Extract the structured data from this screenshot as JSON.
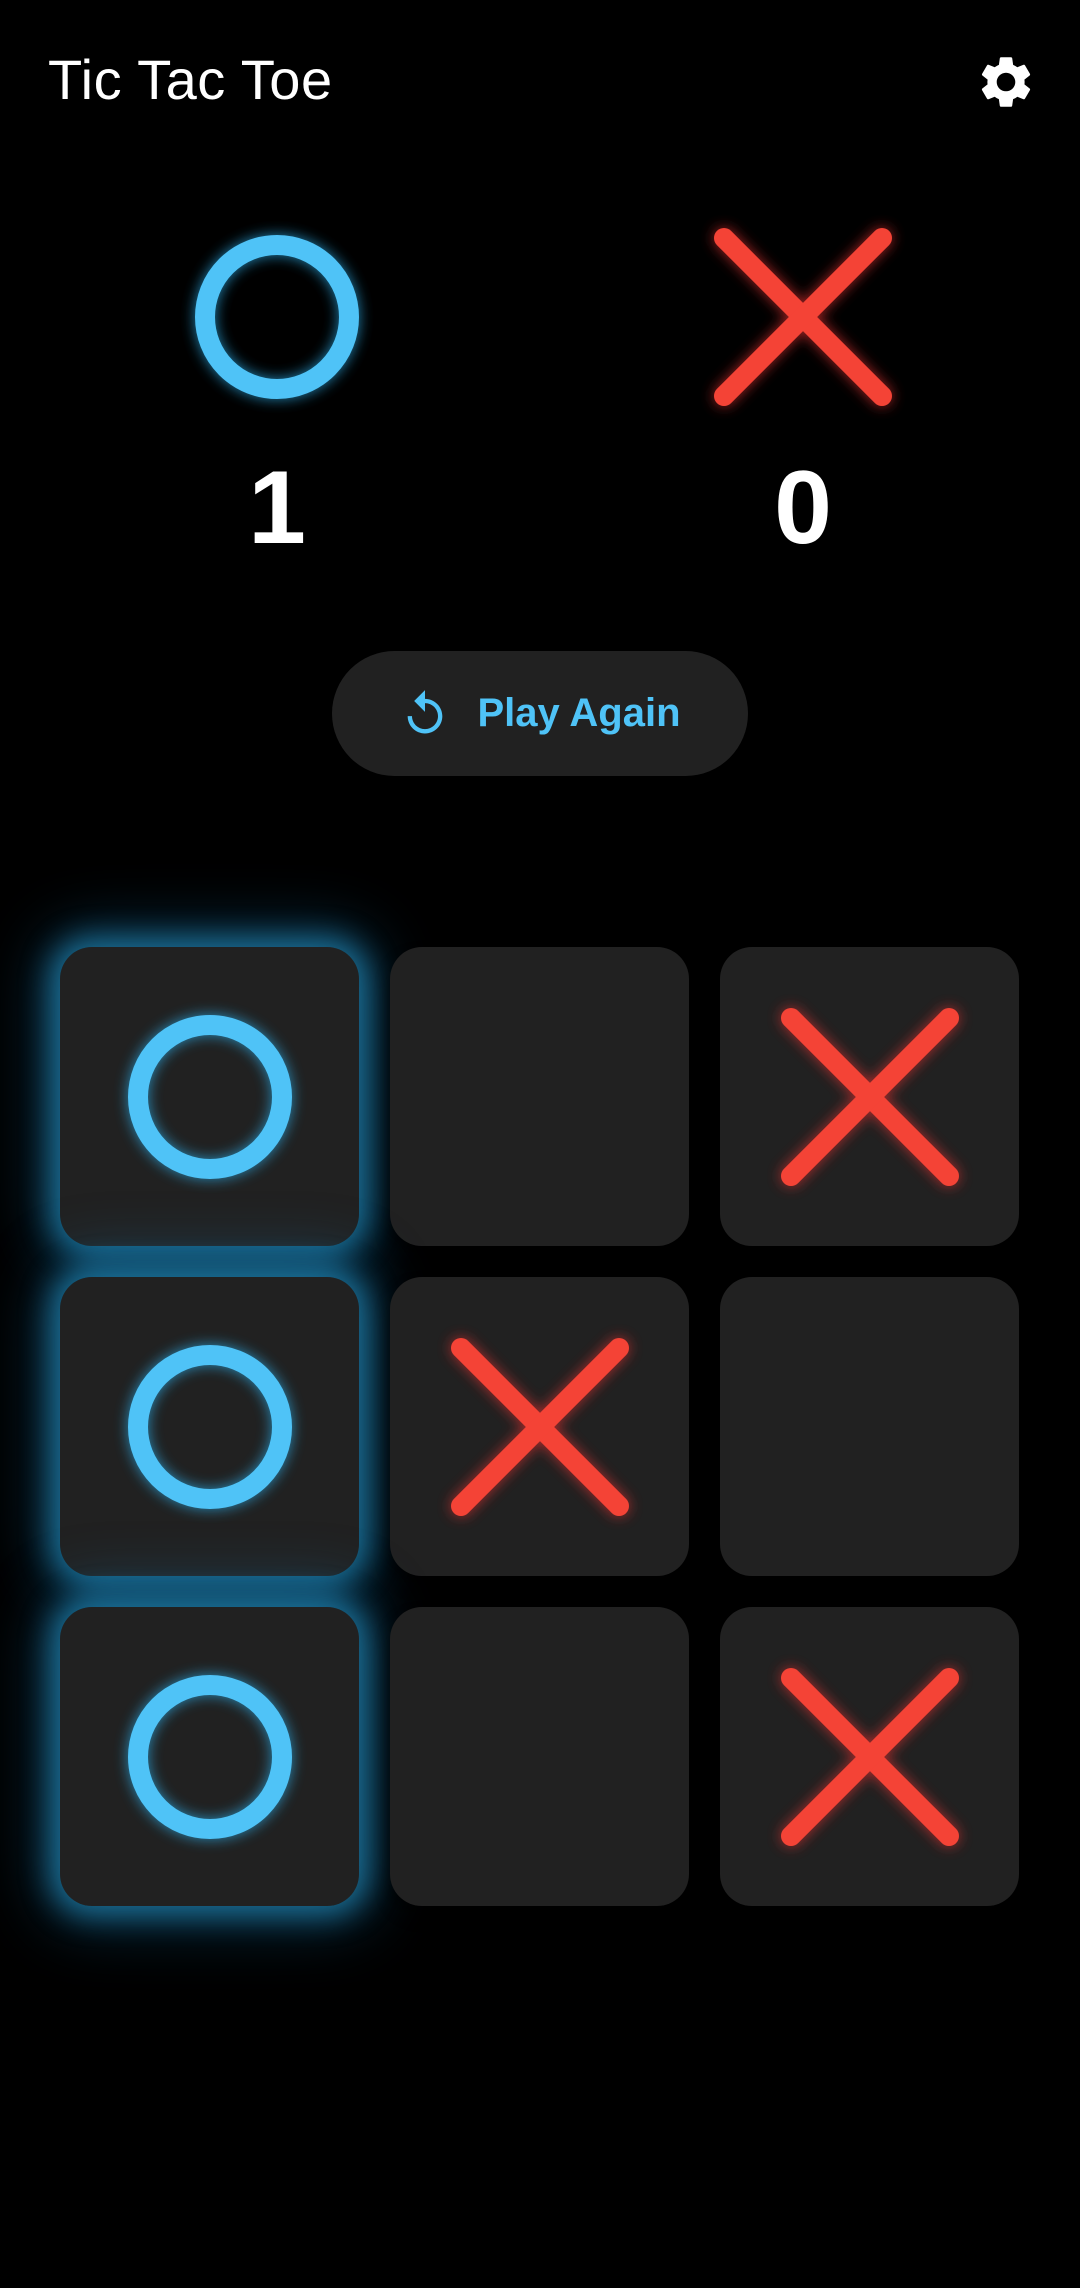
{
  "app": {
    "title": "Tic Tac Toe",
    "settings_icon": "gear-icon"
  },
  "scoreboard": {
    "o": {
      "symbol": "O",
      "score": "1",
      "color": "#4fc3f7"
    },
    "x": {
      "symbol": "X",
      "score": "0",
      "color": "#f44336"
    }
  },
  "actions": {
    "play_again_label": "Play Again",
    "play_again_icon": "replay-icon"
  },
  "board": {
    "cells": [
      "O",
      "",
      "X",
      "O",
      "X",
      "",
      "O",
      "",
      "X"
    ],
    "winning_cells": [
      0,
      3,
      6
    ],
    "winner": "O"
  },
  "colors": {
    "background": "#000000",
    "cell": "#212121",
    "o_accent": "#4fc3f7",
    "x_accent": "#f44336"
  }
}
